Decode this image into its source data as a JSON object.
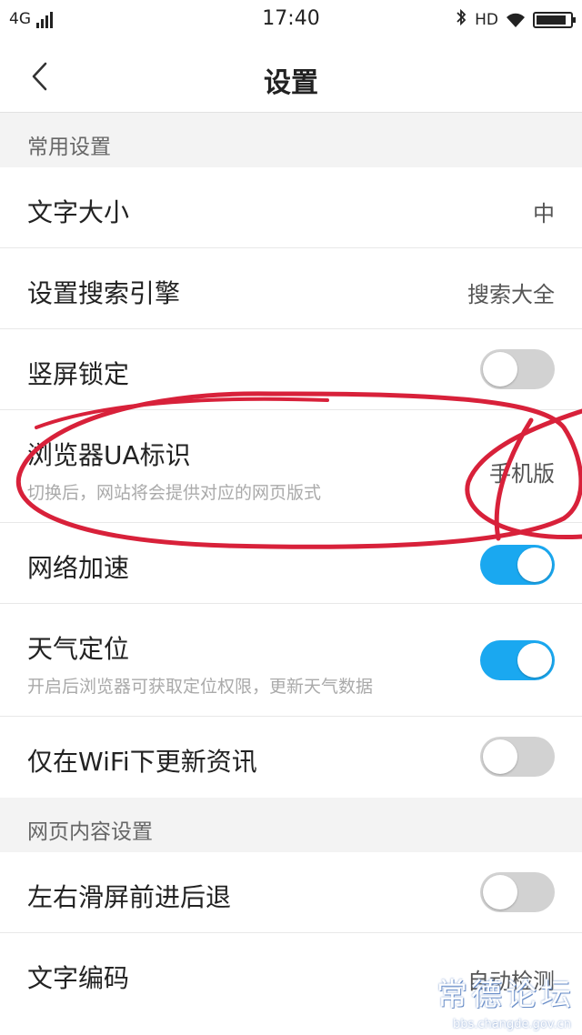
{
  "status_bar": {
    "network": "4G",
    "time": "17:40",
    "hd": "HD",
    "battery_level": 0.9
  },
  "nav": {
    "title": "设置"
  },
  "sections": {
    "common": {
      "header": "常用设置"
    },
    "web": {
      "header": "网页内容设置"
    }
  },
  "rows": {
    "font_size": {
      "title": "文字大小",
      "value": "中"
    },
    "search_engine": {
      "title": "设置搜索引擎",
      "value": "搜索大全"
    },
    "screen_lock": {
      "title": "竖屏锁定",
      "toggle": false
    },
    "ua": {
      "title": "浏览器UA标识",
      "subtitle": "切换后，网站将会提供对应的网页版式",
      "value": "手机版"
    },
    "network_accel": {
      "title": "网络加速",
      "toggle": true
    },
    "weather": {
      "title": "天气定位",
      "subtitle": "开启后浏览器可获取定位权限，更新天气数据",
      "toggle": true
    },
    "wifi_news": {
      "title": "仅在WiFi下更新资讯",
      "toggle": false
    },
    "swipe_nav": {
      "title": "左右滑屏前进后退",
      "toggle": false
    },
    "encoding": {
      "title": "文字编码",
      "value": "自动检测"
    }
  },
  "watermark": {
    "text": "常德论坛",
    "url": "bbs.changde.gov.cn"
  },
  "colors": {
    "toggle_on": "#1aa8f0",
    "toggle_off": "#d2d2d2",
    "annotation": "#d8213a"
  }
}
